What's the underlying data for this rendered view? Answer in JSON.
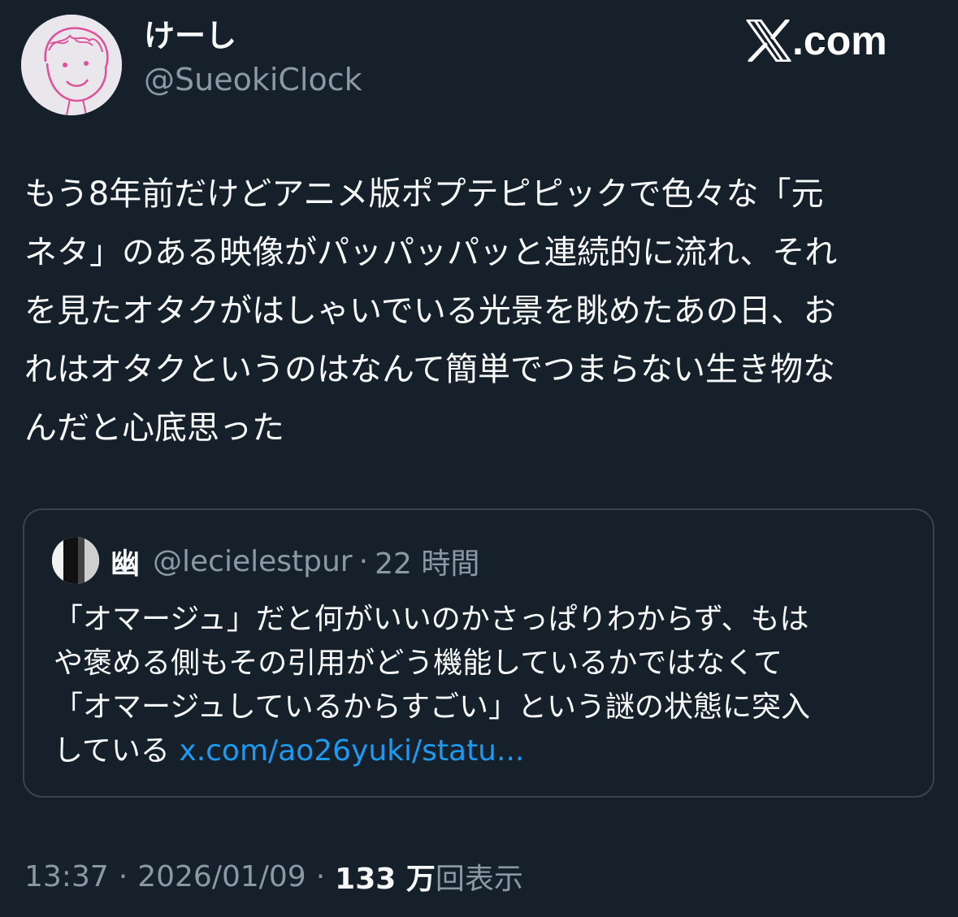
{
  "author": {
    "display_name": "けーし",
    "handle": "@SueokiClock",
    "avatar_icon": "hand-drawn-face-avatar"
  },
  "brand": {
    "label": ".com",
    "icon": "x-logo-icon"
  },
  "tweet": {
    "text": "もう8年前だけどアニメ版ポプテピピックで色々な「元\nネタ」のある映像がパッパッパッと連続的に流れ、それ\nを見たオタクがはしゃいでいる光景を眺めたあの日、お\nれはオタクというのはなんて簡単でつまらない生き物な\nんだと心底思った"
  },
  "quote": {
    "name": "幽",
    "handle": "@lecielestpur",
    "separator": "·",
    "time": "22 時間",
    "text": "「オマージュ」だと何がいいのかさっぱりわからず、もは\nや褒める側もその引用がどう機能しているかではなくて\n「オマージュしているからすごい」という謎の状態に突入\nしている ",
    "link": "x.com/ao26yuki/statu..."
  },
  "meta": {
    "time": "13:37",
    "separator": "·",
    "date": "2026/01/09",
    "views_count": "133 万",
    "views_label": "回表示"
  },
  "colors": {
    "background": "#15202b",
    "text_primary": "#f7f9f9",
    "text_secondary": "#8b98a5",
    "link": "#1d9bf0",
    "border": "#38444d"
  }
}
